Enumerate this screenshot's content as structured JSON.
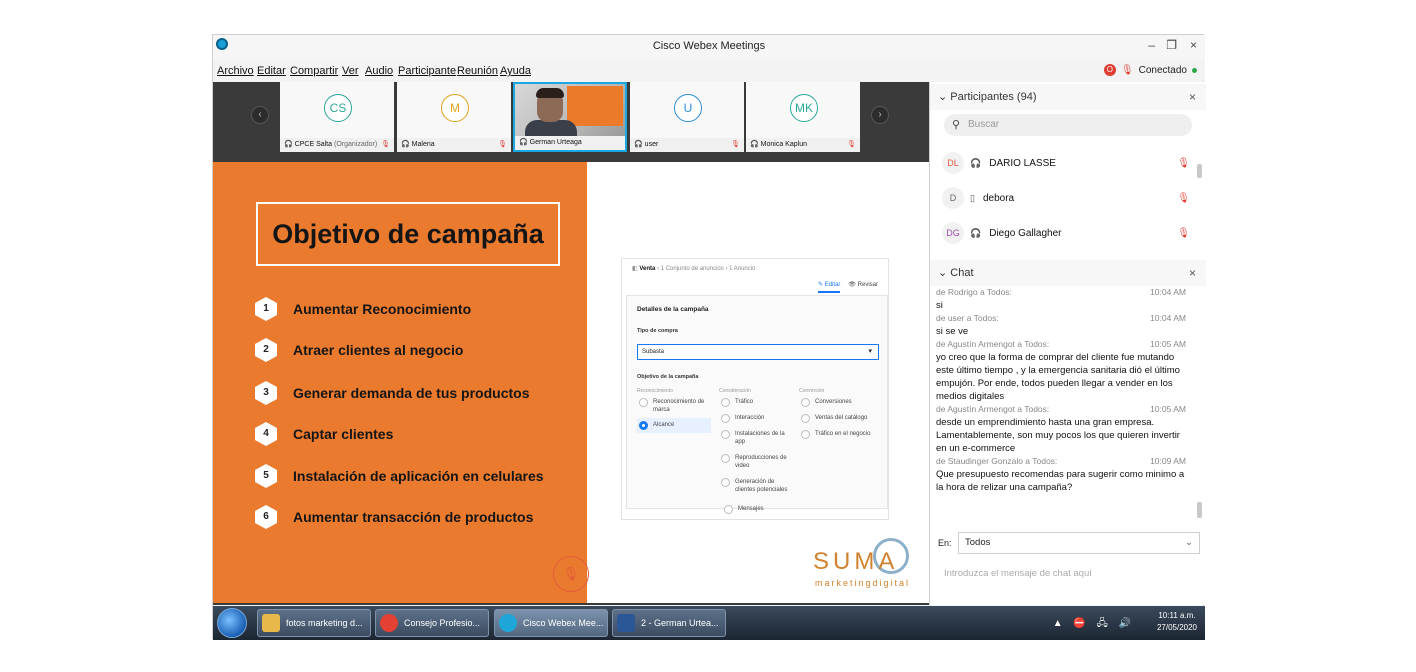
{
  "window": {
    "title": "Cisco Webex Meetings",
    "minimize": "–",
    "restore": "❐",
    "close": "×"
  },
  "menu": [
    "Archivo",
    "Editar",
    "Compartir",
    "Ver",
    "Audio",
    "Participante",
    "Reunión",
    "Ayuda"
  ],
  "status": {
    "rec_badge": "O",
    "mic": "🎙",
    "label": "Conectado"
  },
  "strip": {
    "prev": "‹",
    "next": "›",
    "tiles": [
      {
        "initials": "CS",
        "color": "#2aa89a",
        "name": "CPCE Salta",
        "role": "(Organizador)"
      },
      {
        "initials": "M",
        "color": "#e0a21b",
        "name": "Malena",
        "role": ""
      },
      {
        "initials": "",
        "color": "",
        "name": "German Urteaga",
        "role": ""
      },
      {
        "initials": "U",
        "color": "#2a8fd8",
        "name": "user",
        "role": ""
      },
      {
        "initials": "MK",
        "color": "#2aa89a",
        "name": "Monica Kaplun",
        "role": ""
      }
    ]
  },
  "slide": {
    "title": "Objetivo de campaña",
    "objectives": [
      {
        "n": "1",
        "text": "Aumentar Reconocimiento"
      },
      {
        "n": "2",
        "text": "Atraer clientes al negocio"
      },
      {
        "n": "3",
        "text": "Generar demanda de tus productos"
      },
      {
        "n": "4",
        "text": "Captar clientes"
      },
      {
        "n": "5",
        "text": "Instalación de aplicación en celulares"
      },
      {
        "n": "6",
        "text": "Aumentar transacción de productos"
      }
    ],
    "screenshot": {
      "crumb_main": "Venta",
      "crumb_rest": " ›  1 Conjunto de anuncios  ›  1 Anuncio",
      "tab_edit": "✎ Editar",
      "tab_review": "👁 Revisar",
      "card_title": "Detalles de la campaña",
      "buy_label": "Tipo de compra",
      "buy_value": "Subasta",
      "obj_label": "Objetivo de la campaña",
      "col1": "Reconocimiento",
      "col2": "Consideración",
      "col3": "Conversión",
      "opt_marca": "Reconocimiento de marca",
      "opt_alcance": "Alcance",
      "opt_trafico": "Tráfico",
      "opt_interaccion": "Interacción",
      "opt_instalaciones": "Instalaciones de la app",
      "opt_reproducciones": "Reproducciones de video",
      "opt_generacion": "Generación de clientes potenciales",
      "opt_mensajes": "Mensajes",
      "opt_conversiones": "Conversiones",
      "opt_ventas": "Ventas del catálogo",
      "opt_trafico_negocio": "Tráfico en el negocio"
    },
    "brand": "SUMA",
    "brand_sub": "marketingdigital",
    "mic_icon": "🎙"
  },
  "participants": {
    "header": "Participantes (94)",
    "search_placeholder": "Buscar",
    "list": [
      {
        "initials": "DL",
        "color": "#e05a4a",
        "device": "🎧",
        "name": "DARIO LASSE"
      },
      {
        "initials": "D",
        "color": "#666666",
        "device": "▯",
        "name": "debora"
      },
      {
        "initials": "DG",
        "color": "#a04ab0",
        "device": "🎧",
        "name": "Diego Gallagher"
      }
    ]
  },
  "chat": {
    "header": "Chat",
    "messages": [
      {
        "from": "de Rodrigo a Todos:",
        "time": "10:04 AM",
        "text": "si"
      },
      {
        "from": "de user a Todos:",
        "time": "10:04 AM",
        "text": "si se ve"
      },
      {
        "from": "de Agustín Armengot a Todos:",
        "time": "10:05 AM",
        "text": "yo creo que la forma de comprar del cliente fue mutando este último tiempo , y la emergencia sanitaria dió el último empujón. Por ende, todos pueden llegar a vender en los medios digitales"
      },
      {
        "from": "de Agustín Armengot a Todos:",
        "time": "10:05 AM",
        "text": "desde un emprendimiento hasta una gran empresa. Lamentablemente, son muy pocos los que quieren invertir en un e-commerce"
      },
      {
        "from": "de Staudinger Gonzalo a Todos:",
        "time": "10:09 AM",
        "text": "Que presupuesto recomendas para sugerir como minimo a la hora de relizar una campaña?"
      }
    ],
    "to_label": "En:",
    "to_value": "Todos",
    "input_placeholder": "Introduzca el mensaje de chat aquí"
  },
  "taskbar": {
    "items": [
      {
        "label": "fotos marketing d...",
        "icon_color": "#e8b84a"
      },
      {
        "label": "Consejo Profesio...",
        "icon_color": "#e34133"
      },
      {
        "label": "Cisco Webex Mee...",
        "icon_color": "#1ea6d8"
      },
      {
        "label": "2 - German Urtea...",
        "icon_color": "#2b5797"
      }
    ],
    "tray_icons": "▲ ⛔ 🖧 🔊",
    "time": "10:11 a.m.",
    "date": "27/05/2020"
  }
}
